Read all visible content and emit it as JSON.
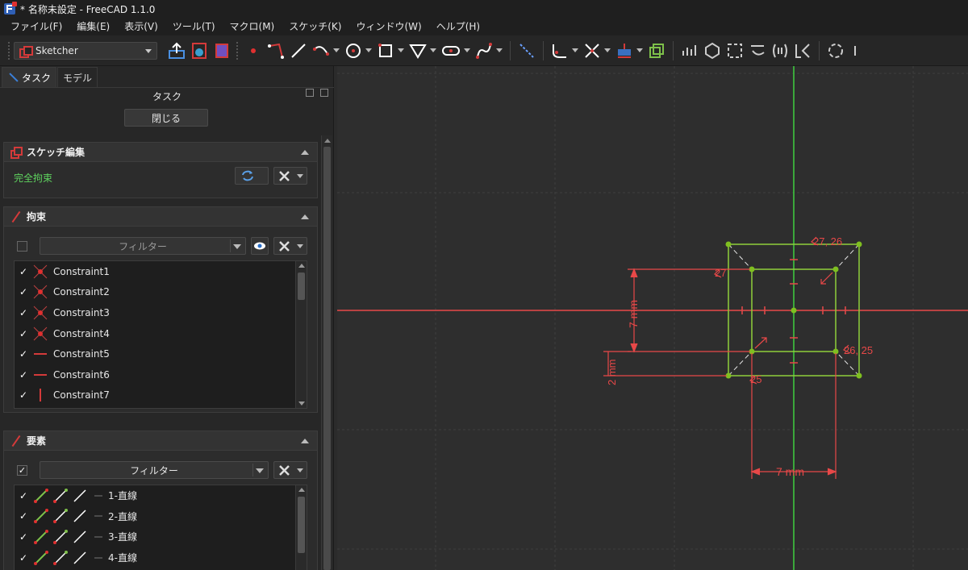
{
  "window": {
    "title": "* 名称未設定 - FreeCAD 1.1.0"
  },
  "menu": [
    "ファイル(F)",
    "編集(E)",
    "表示(V)",
    "ツール(T)",
    "マクロ(M)",
    "スケッチ(K)",
    "ウィンドウ(W)",
    "ヘルプ(H)"
  ],
  "toolbar": {
    "workbench": "Sketcher"
  },
  "panel": {
    "tabs": [
      "タスク",
      "モデル"
    ],
    "task_title": "タスク",
    "close_label": "閉じる",
    "edit_section": {
      "title": "スケッチ編集",
      "status": "完全拘束"
    },
    "constraints_section": {
      "title": "拘束",
      "filter_placeholder": "フィルター",
      "items": [
        {
          "label": "Constraint1",
          "icon": "coincident-icon"
        },
        {
          "label": "Constraint2",
          "icon": "coincident-icon"
        },
        {
          "label": "Constraint3",
          "icon": "coincident-icon"
        },
        {
          "label": "Constraint4",
          "icon": "coincident-icon"
        },
        {
          "label": "Constraint5",
          "icon": "horizontal-icon"
        },
        {
          "label": "Constraint6",
          "icon": "horizontal-icon"
        },
        {
          "label": "Constraint7",
          "icon": "vertical-icon"
        }
      ]
    },
    "elements_section": {
      "title": "要素",
      "filter_label": "フィルター",
      "items": [
        {
          "label": "1-直線"
        },
        {
          "label": "2-直線"
        },
        {
          "label": "3-直線"
        },
        {
          "label": "4-直線"
        }
      ]
    }
  },
  "sketch": {
    "dim_vertical": "7 mm",
    "dim_horizontal": "7 mm",
    "dim_small": "2 mm",
    "labels": [
      "27, 26",
      "27",
      "26, 25",
      "25"
    ],
    "colors": {
      "construction": "#e84848",
      "geometry": "#8fcf3a",
      "vertical_axis": "#3ecf3e",
      "points": "#7fbf20"
    }
  }
}
